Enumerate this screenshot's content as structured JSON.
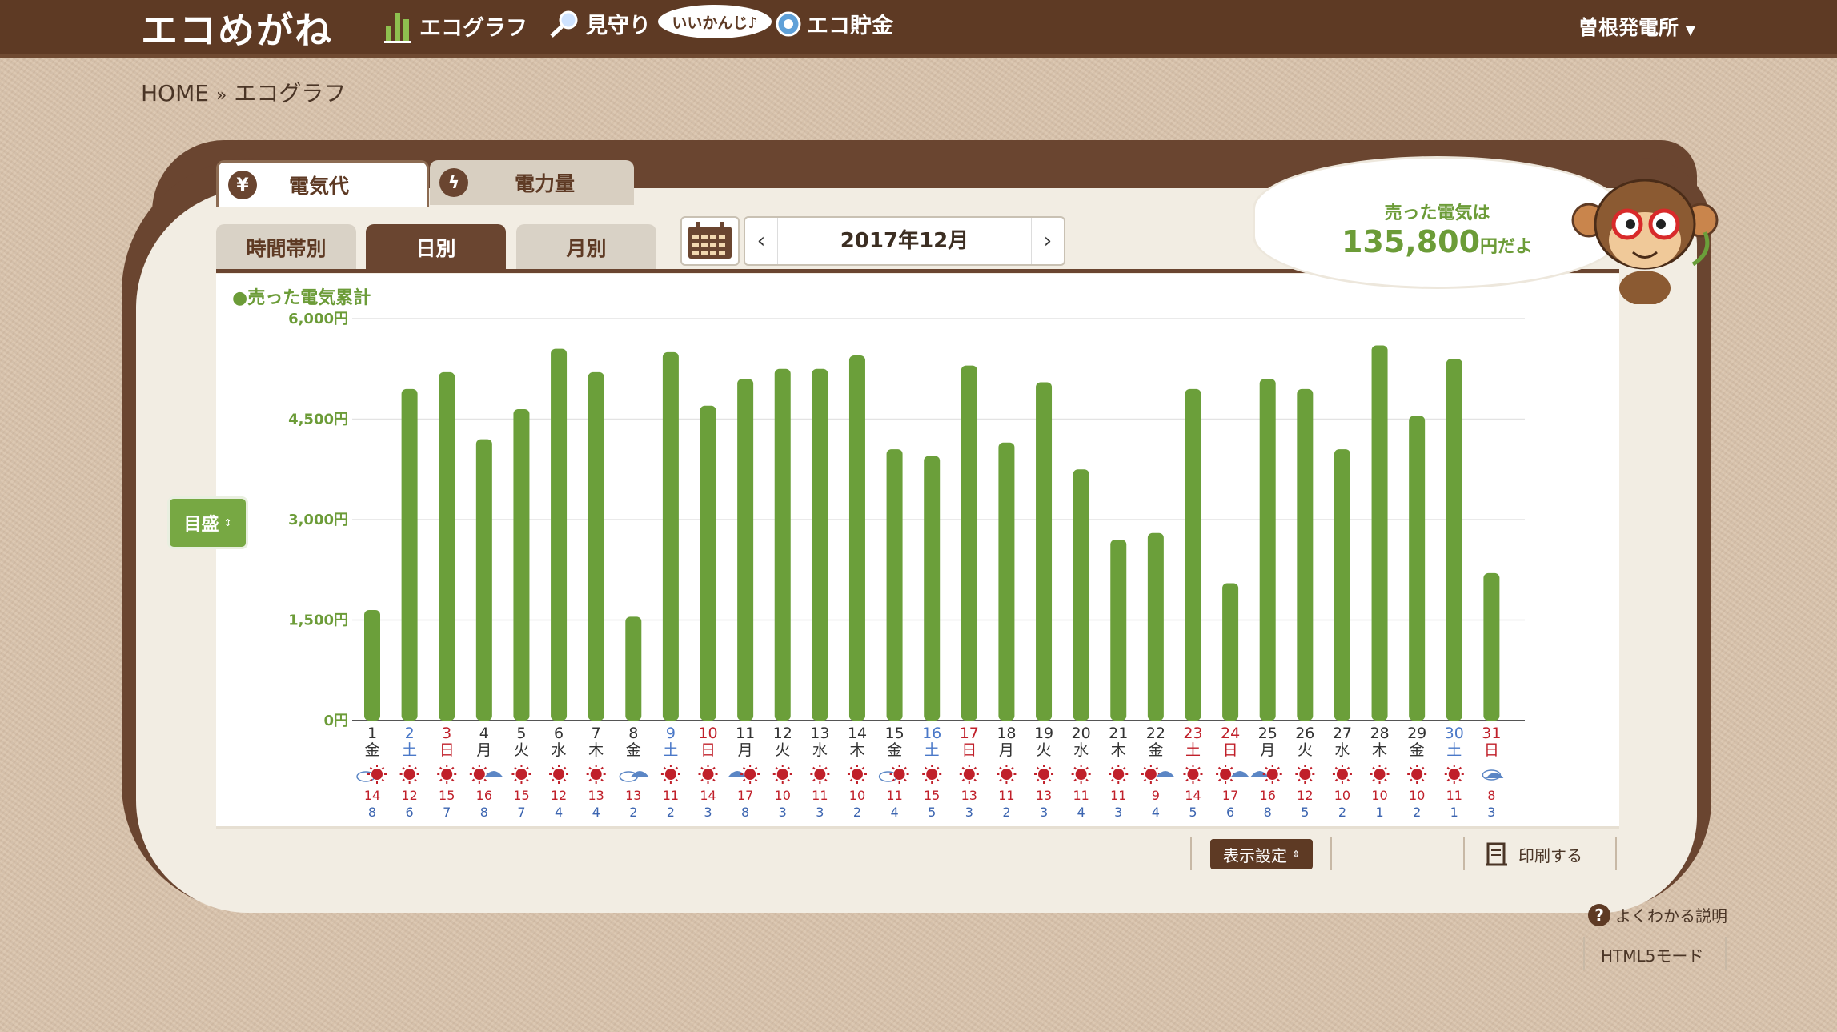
{
  "header": {
    "logo": "エコめがね",
    "nav": [
      {
        "label": "エコグラフ",
        "icon": "bar-graph-icon"
      },
      {
        "label": "見守り",
        "icon": "magnifier-icon"
      },
      {
        "label": "エコ貯金",
        "icon": "piggy-coin-icon"
      }
    ],
    "status_pill": "いいかんじ♪",
    "user": "曽根発電所"
  },
  "breadcrumb": {
    "home": "HOME",
    "separator": "»",
    "current": "エコグラフ"
  },
  "tabs": [
    {
      "label": "電気代",
      "icon": "yen-icon"
    },
    {
      "label": "電力量",
      "icon": "lightning-icon"
    }
  ],
  "subtabs": [
    "時間帯別",
    "日別",
    "月別"
  ],
  "date": {
    "prev": "‹",
    "label": "2017年12月",
    "next": "›"
  },
  "bubble": {
    "line1": "売った電気は",
    "amount": "135,800",
    "suffix": "円だよ"
  },
  "scale_button": "目盛",
  "bottom": {
    "display_settings": "表示設定",
    "print": "印刷する",
    "help": "よくわかる説明",
    "html5": "HTML5モード"
  },
  "colors": {
    "bar": "#6b9f3a",
    "header": "#5e3a24",
    "saturday": "#4a78c8",
    "sunday": "#c0202a"
  },
  "chart_data": {
    "type": "bar",
    "legend": "●売った電気累計",
    "y_ticks": [
      "6,000円",
      "4,500円",
      "3,000円",
      "1,500円",
      "0円"
    ],
    "ylim": [
      0,
      6000
    ],
    "categories": [
      "1",
      "2",
      "3",
      "4",
      "5",
      "6",
      "7",
      "8",
      "9",
      "10",
      "11",
      "12",
      "13",
      "14",
      "15",
      "16",
      "17",
      "18",
      "19",
      "20",
      "21",
      "22",
      "23",
      "24",
      "25",
      "26",
      "27",
      "28",
      "29",
      "30",
      "31"
    ],
    "weekdays": [
      "金",
      "土",
      "日",
      "月",
      "火",
      "水",
      "木",
      "金",
      "土",
      "日",
      "月",
      "火",
      "水",
      "木",
      "金",
      "土",
      "日",
      "月",
      "火",
      "水",
      "木",
      "金",
      "土",
      "日",
      "月",
      "火",
      "水",
      "木",
      "金",
      "土",
      "日"
    ],
    "holiday_colors": [
      "n",
      "sat",
      "sun",
      "n",
      "n",
      "n",
      "n",
      "n",
      "sat",
      "sun",
      "n",
      "n",
      "n",
      "n",
      "n",
      "sat",
      "sun",
      "n",
      "n",
      "n",
      "n",
      "n",
      "sun",
      "sun",
      "n",
      "n",
      "n",
      "n",
      "n",
      "sat",
      "sun"
    ],
    "weather": [
      "cloudy-sun",
      "sunny",
      "sunny",
      "sunny-rain",
      "sunny",
      "sunny",
      "sunny",
      "cloudy-rain",
      "sunny",
      "sunny",
      "rain-sun",
      "sunny",
      "sunny",
      "sunny",
      "cloudy-sun",
      "sunny",
      "sunny",
      "sunny",
      "sunny",
      "sunny",
      "sunny",
      "sunny-rain",
      "sunny",
      "sunny-rain",
      "rain-sun",
      "sunny",
      "sunny",
      "sunny",
      "sunny",
      "sunny",
      "rain"
    ],
    "temp_high": [
      14,
      12,
      15,
      16,
      15,
      12,
      13,
      13,
      11,
      14,
      17,
      10,
      11,
      10,
      11,
      15,
      13,
      11,
      13,
      11,
      11,
      9,
      14,
      17,
      16,
      12,
      10,
      10,
      10,
      11,
      8
    ],
    "temp_low": [
      8,
      6,
      7,
      8,
      7,
      4,
      4,
      2,
      2,
      3,
      8,
      3,
      3,
      2,
      4,
      5,
      3,
      2,
      3,
      4,
      3,
      4,
      5,
      6,
      8,
      5,
      2,
      1,
      2,
      1,
      3
    ],
    "values": [
      1650,
      4950,
      5200,
      4200,
      4650,
      5550,
      5200,
      1550,
      5500,
      4700,
      5100,
      5250,
      5250,
      5450,
      4050,
      3950,
      5300,
      4150,
      5050,
      3750,
      2700,
      2800,
      4950,
      2050,
      5100,
      4950,
      4050,
      5600,
      4550,
      5400,
      2200
    ]
  }
}
